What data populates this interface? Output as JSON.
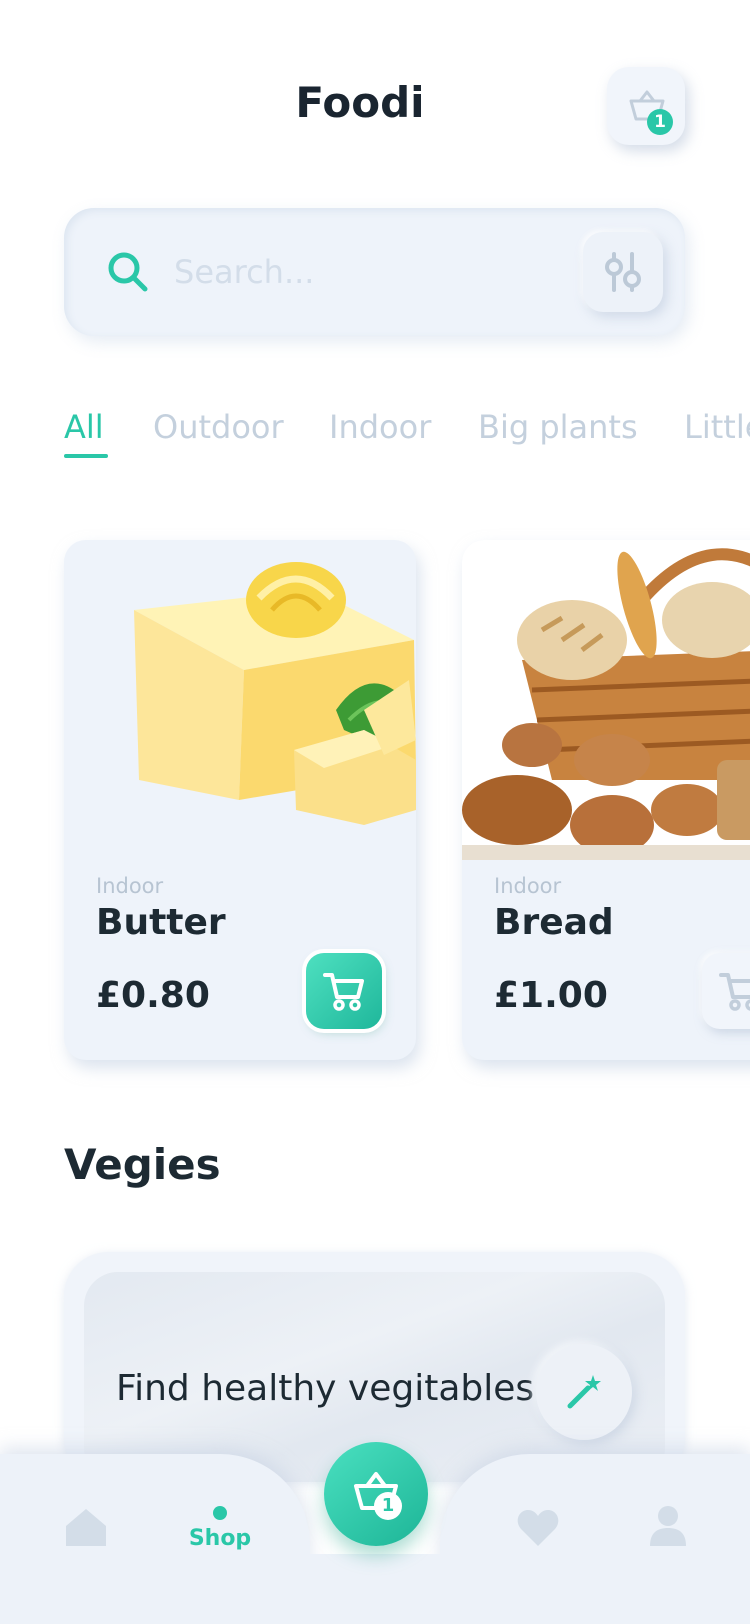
{
  "header": {
    "title": "Foodi",
    "cart_badge": "1",
    "cart_icon": "basket-icon"
  },
  "search": {
    "placeholder": "Search...",
    "value": "",
    "search_icon": "search-icon",
    "filter_icon": "sliders-icon"
  },
  "tabs": [
    {
      "label": "All",
      "active": true
    },
    {
      "label": "Outdoor",
      "active": false
    },
    {
      "label": "Indoor",
      "active": false
    },
    {
      "label": "Big plants",
      "active": false
    },
    {
      "label": "Little",
      "active": false
    }
  ],
  "products": [
    {
      "category": "Indoor",
      "name": "Butter",
      "price": "£0.80",
      "image": "butter-image",
      "add_icon": "cart-icon"
    },
    {
      "category": "Indoor",
      "name": "Bread",
      "price": "£1.00",
      "image": "bread-basket-image",
      "add_icon": "cart-icon"
    }
  ],
  "section": {
    "title": "Vegies"
  },
  "promo": {
    "text": "Find healthy vegitables",
    "icon": "magic-wand-icon"
  },
  "bottom_nav": {
    "items": [
      {
        "icon": "home-icon",
        "label": ""
      },
      {
        "icon": "dot-indicator",
        "label": "Shop",
        "active": true
      },
      {
        "icon": "heart-icon",
        "label": ""
      },
      {
        "icon": "profile-icon",
        "label": ""
      }
    ],
    "fab_icon": "basket-icon",
    "fab_badge": "1"
  },
  "colors": {
    "accent": "#2ac7a8",
    "background": "#ffffff",
    "card": "#eef3fa",
    "muted_text": "#c4d0dd",
    "text": "#1d2a33"
  }
}
